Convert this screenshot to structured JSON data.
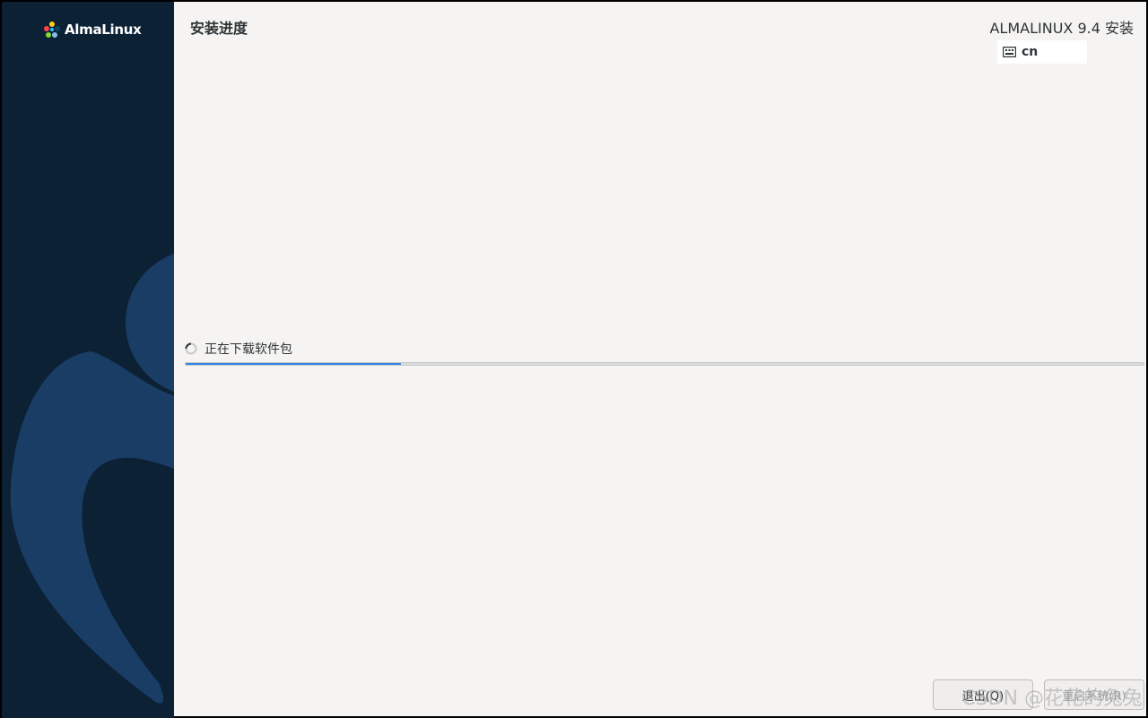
{
  "sidebar": {
    "logo_text": "AlmaLinux"
  },
  "header": {
    "page_title": "安装进度",
    "product_title": "ALMALINUX 9.4 安装",
    "keyboard_layout": "cn"
  },
  "progress": {
    "status_text": "正在下载软件包",
    "fraction": 0.225
  },
  "footer": {
    "quit_label": "退出(Q)",
    "reboot_label": "重启系统(R)"
  },
  "watermark": "CSDN @花花的兔兔",
  "colors": {
    "sidebar_bg": "#0d2135",
    "sidebar_art": "#1a3d66",
    "progress_fill": "#3584e4",
    "main_bg": "#f5f4f3"
  }
}
